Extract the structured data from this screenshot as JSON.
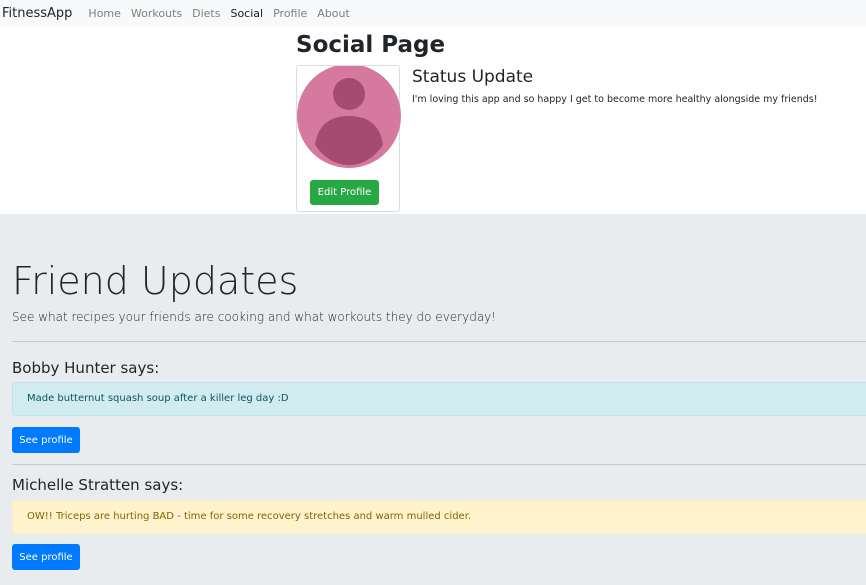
{
  "navbar": {
    "brand": "FitnessApp",
    "links": [
      {
        "label": "Home",
        "active": false
      },
      {
        "label": "Workouts",
        "active": false
      },
      {
        "label": "Diets",
        "active": false
      },
      {
        "label": "Social",
        "active": true
      },
      {
        "label": "Profile",
        "active": false
      },
      {
        "label": "About",
        "active": false
      }
    ]
  },
  "page": {
    "title": "Social Page",
    "profile": {
      "avatar_icon": "user-avatar-icon",
      "edit_label": "Edit Profile"
    },
    "status": {
      "heading": "Status Update",
      "text": "I'm loving this app and so happy I get to become more healthy alongside my friends!"
    }
  },
  "friends_section": {
    "title": "Friend Updates",
    "lead": "See what recipes your friends are cooking and what workouts they do everyday!",
    "friends": [
      {
        "name": "Bobby Hunter says:",
        "message": "Made butternut squash soup after a killer leg day :D",
        "style": "info",
        "button_label": "See profile"
      },
      {
        "name": "Michelle Stratten says:",
        "message": "OW!! Triceps are hurting BAD - time for some recovery stretches and warm mulled cider.",
        "style": "warning",
        "button_label": "See profile"
      }
    ]
  },
  "colors": {
    "primary": "#007bff",
    "success": "#28a745",
    "avatar_bg": "#d6799e",
    "avatar_fg": "#a54a70",
    "jumbotron_bg": "#e9ecef"
  }
}
